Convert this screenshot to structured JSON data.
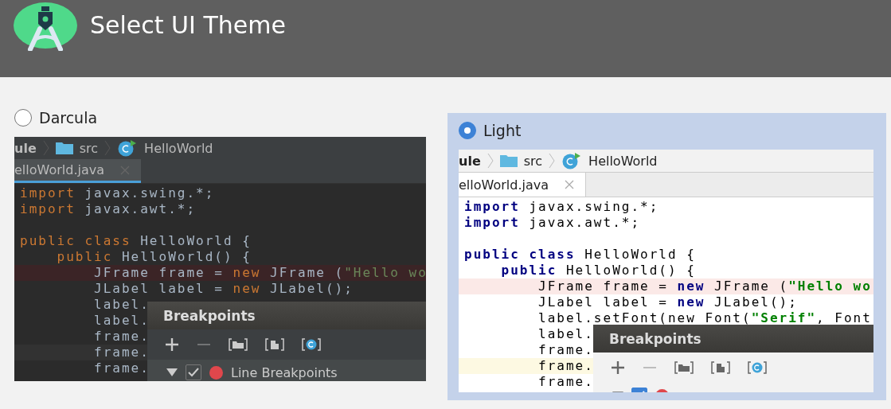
{
  "header": {
    "title": "Select UI Theme"
  },
  "themes": [
    {
      "label": "Darcula",
      "selected": false,
      "kind": "dark",
      "preview": {
        "breadcrumb": [
          "ule",
          "src",
          "HelloWorld"
        ],
        "tab": "elloWorld.java",
        "lines": [
          {
            "kind": "code",
            "tokens": [
              {
                "kind": "keyword",
                "text": "import"
              },
              {
                "kind": "plain",
                "text": " javax.swing.*;"
              }
            ]
          },
          {
            "kind": "code",
            "tokens": [
              {
                "kind": "keyword",
                "text": "import"
              },
              {
                "kind": "plain",
                "text": " javax.awt.*;"
              }
            ]
          },
          {
            "kind": "blank"
          },
          {
            "kind": "code",
            "tokens": [
              {
                "kind": "keyword",
                "text": "public class"
              },
              {
                "kind": "plain",
                "text": " HelloWorld {"
              }
            ]
          },
          {
            "kind": "code",
            "tokens": [
              {
                "kind": "keyword",
                "text": "    public"
              },
              {
                "kind": "plain",
                "text": " HelloWorld() {"
              }
            ]
          },
          {
            "kind": "error",
            "tokens": [
              {
                "kind": "plain",
                "text": "        JFrame frame = "
              },
              {
                "kind": "keyword",
                "text": "new"
              },
              {
                "kind": "plain",
                "text": " JFrame ("
              },
              {
                "kind": "string",
                "text": "\"Hello wo"
              }
            ]
          },
          {
            "kind": "code",
            "tokens": [
              {
                "kind": "plain",
                "text": "        JLabel label = "
              },
              {
                "kind": "keyword",
                "text": "new"
              },
              {
                "kind": "plain",
                "text": " JLabel();"
              }
            ]
          },
          {
            "kind": "code",
            "tokens": [
              {
                "kind": "plain",
                "text": "        label."
              }
            ]
          },
          {
            "kind": "code",
            "tokens": [
              {
                "kind": "plain",
                "text": "        label."
              }
            ]
          },
          {
            "kind": "code",
            "tokens": [
              {
                "kind": "plain",
                "text": "        frame."
              }
            ]
          },
          {
            "kind": "current",
            "tokens": [
              {
                "kind": "plain",
                "text": "        frame."
              }
            ]
          },
          {
            "kind": "code",
            "tokens": [
              {
                "kind": "plain",
                "text": "        frame."
              }
            ]
          }
        ],
        "dialog": {
          "title": "Breakpoints",
          "row": {
            "label": "Line Breakpoints",
            "checked": true
          }
        }
      }
    },
    {
      "label": "Light",
      "selected": true,
      "kind": "light",
      "preview": {
        "breadcrumb": [
          "ule",
          "src",
          "HelloWorld"
        ],
        "tab": "elloWorld.java",
        "lines": [
          {
            "kind": "code",
            "tokens": [
              {
                "kind": "keyword",
                "text": "import"
              },
              {
                "kind": "plain",
                "text": " javax.swing.*;"
              }
            ]
          },
          {
            "kind": "code",
            "tokens": [
              {
                "kind": "keyword",
                "text": "import"
              },
              {
                "kind": "plain",
                "text": " javax.awt.*;"
              }
            ]
          },
          {
            "kind": "blank"
          },
          {
            "kind": "code",
            "tokens": [
              {
                "kind": "keyword",
                "text": "public class"
              },
              {
                "kind": "plain",
                "text": " HelloWorld {"
              }
            ]
          },
          {
            "kind": "code",
            "tokens": [
              {
                "kind": "keyword",
                "text": "    public"
              },
              {
                "kind": "plain",
                "text": " HelloWorld() {"
              }
            ]
          },
          {
            "kind": "error",
            "tokens": [
              {
                "kind": "plain",
                "text": "        JFrame frame = "
              },
              {
                "kind": "keyword",
                "text": "new"
              },
              {
                "kind": "plain",
                "text": " JFrame ("
              },
              {
                "kind": "string",
                "text": "\"Hello wo"
              }
            ]
          },
          {
            "kind": "code",
            "tokens": [
              {
                "kind": "plain",
                "text": "        JLabel label = "
              },
              {
                "kind": "keyword",
                "text": "new"
              },
              {
                "kind": "plain",
                "text": " JLabel();"
              }
            ]
          },
          {
            "kind": "code",
            "tokens": [
              {
                "kind": "plain",
                "text": "        label.setFont(new Font("
              },
              {
                "kind": "string",
                "text": "\"Serif\""
              },
              {
                "kind": "plain",
                "text": ", Font"
              }
            ]
          },
          {
            "kind": "code",
            "tokens": [
              {
                "kind": "plain",
                "text": "        label."
              }
            ]
          },
          {
            "kind": "code",
            "tokens": [
              {
                "kind": "plain",
                "text": "        frame."
              }
            ]
          },
          {
            "kind": "current",
            "tokens": [
              {
                "kind": "plain",
                "text": "        frame."
              }
            ]
          },
          {
            "kind": "code",
            "tokens": [
              {
                "kind": "plain",
                "text": "        frame."
              }
            ]
          }
        ],
        "dialog": {
          "title": "Breakpoints",
          "row": {
            "checked": true
          }
        }
      }
    }
  ]
}
